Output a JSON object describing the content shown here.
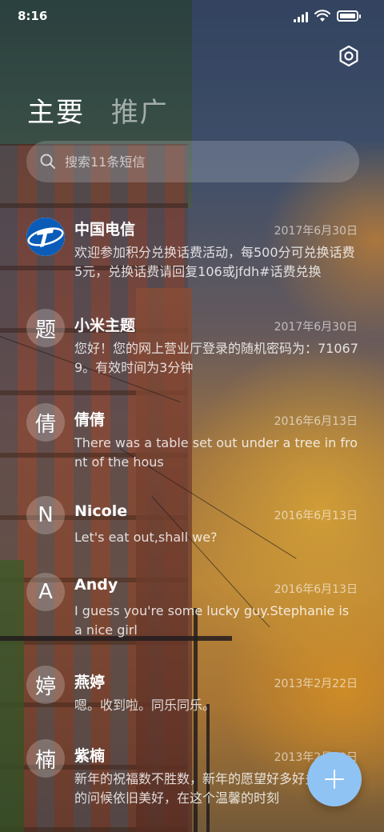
{
  "status_bar": {
    "time": "8:16"
  },
  "tabs": [
    {
      "label": "主要",
      "active": true
    },
    {
      "label": "推广",
      "active": false
    }
  ],
  "search": {
    "placeholder": "搜索11条短信"
  },
  "conversations": [
    {
      "avatar_text": "",
      "avatar_icon": "china-telecom-logo-icon",
      "name": "中国电信",
      "date": "2017年6月30日",
      "preview": "欢迎参加积分兑换话费活动，每500分可兑换话费5元，兑换话费请回复106或jfdh#话费兑换"
    },
    {
      "avatar_text": "题",
      "name": "小米主题",
      "date": "2017年6月30日",
      "preview": "您好！您的网上营业厅登录的随机密码为：710679。有效时间为3分钟"
    },
    {
      "avatar_text": "倩",
      "name": "倩倩",
      "date": "2016年6月13日",
      "preview": "There was a table set out under a tree in front of the hous"
    },
    {
      "avatar_text": "N",
      "name": "Nicole",
      "date": "2016年6月13日",
      "preview": "Let's eat out,shall we?"
    },
    {
      "avatar_text": "A",
      "name": "Andy",
      "date": "2016年6月13日",
      "preview": "I guess you're some lucky guy.Stephanie is a nice girl"
    },
    {
      "avatar_text": "婷",
      "name": "燕婷",
      "date": "2013年2月22日",
      "preview": "嗯。收到啦。同乐同乐。"
    },
    {
      "avatar_text": "楠",
      "name": "紫楠",
      "date": "2013年2月22日",
      "preview": "新年的祝福数不胜数，新年的愿望好多好多，新年的问候依旧美好，在这个温馨的时刻"
    }
  ],
  "colors": {
    "fab": "#8fc3f4"
  }
}
